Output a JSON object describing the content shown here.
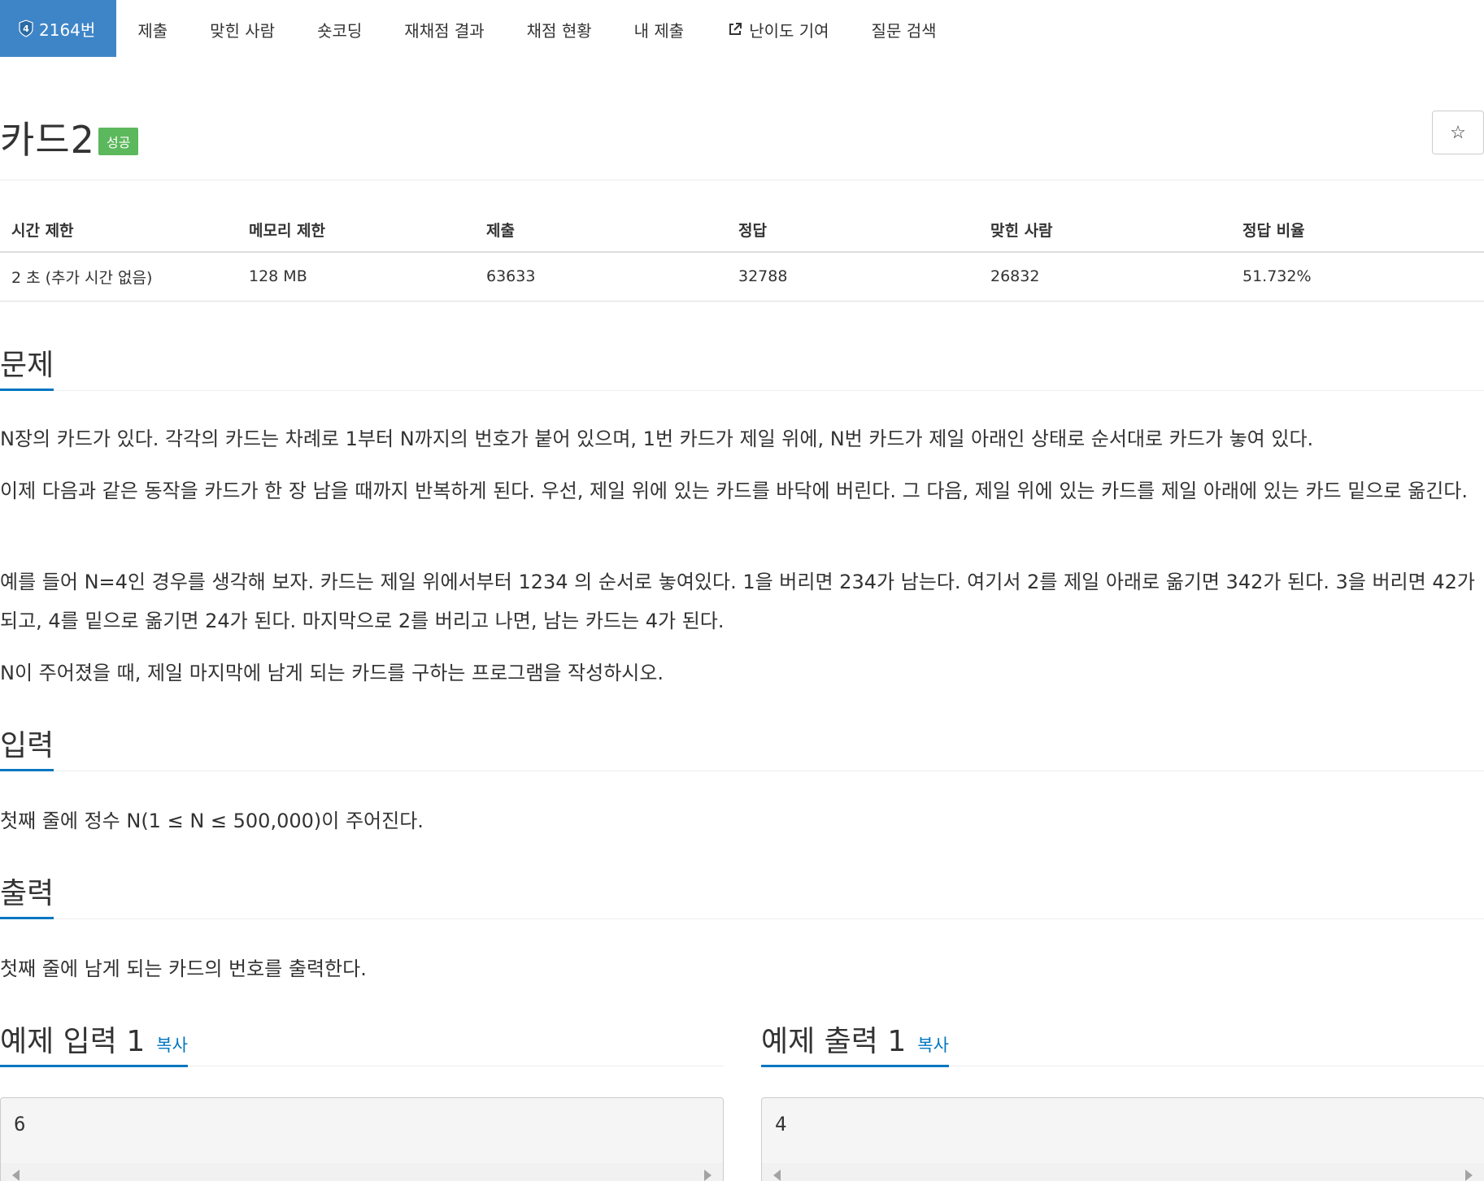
{
  "nav": {
    "problem_tab": "2164번",
    "tier_badge": "4",
    "items": [
      "제출",
      "맞힌 사람",
      "숏코딩",
      "재채점 결과",
      "채점 현황",
      "내 제출",
      "난이도 기여",
      "질문 검색"
    ]
  },
  "problem": {
    "title": "카드2",
    "status_badge": "성공",
    "star": "☆"
  },
  "stats": {
    "headers": [
      "시간 제한",
      "메모리 제한",
      "제출",
      "정답",
      "맞힌 사람",
      "정답 비율"
    ],
    "values": [
      "2 초 (추가 시간 없음)",
      "128 MB",
      "63633",
      "32788",
      "26832",
      "51.732%"
    ]
  },
  "sections": {
    "problem_title": "문제",
    "problem_paragraphs": [
      "N장의 카드가 있다. 각각의 카드는 차례로 1부터 N까지의 번호가 붙어 있으며, 1번 카드가 제일 위에, N번 카드가 제일 아래인 상태로 순서대로 카드가 놓여 있다.",
      "이제 다음과 같은 동작을 카드가 한 장 남을 때까지 반복하게 된다. 우선, 제일 위에 있는 카드를 바닥에 버린다. 그 다음, 제일 위에 있는 카드를 제일 아래에 있는 카드 밑으로 옮긴다.",
      "예를 들어 N=4인 경우를 생각해 보자. 카드는 제일 위에서부터 1234 의 순서로 놓여있다. 1을 버리면 234가 남는다. 여기서 2를 제일 아래로 옮기면 342가 된다. 3을 버리면 42가 되고, 4를 밑으로 옮기면 24가 된다. 마지막으로 2를 버리고 나면, 남는 카드는 4가 된다.",
      "N이 주어졌을 때, 제일 마지막에 남게 되는 카드를 구하는 프로그램을 작성하시오."
    ],
    "input_title": "입력",
    "input_text": "첫째 줄에 정수 N(1 ≤ N ≤ 500,000)이 주어진다.",
    "output_title": "출력",
    "output_text": "첫째 줄에 남게 되는 카드의 번호를 출력한다."
  },
  "samples": {
    "input_title": "예제 입력 1",
    "output_title": "예제 출력 1",
    "copy_label": "복사",
    "input_value": "6",
    "output_value": "4"
  },
  "colors": {
    "accent": "#3e85c8",
    "link": "#0076c0",
    "success": "#5cb85c"
  }
}
